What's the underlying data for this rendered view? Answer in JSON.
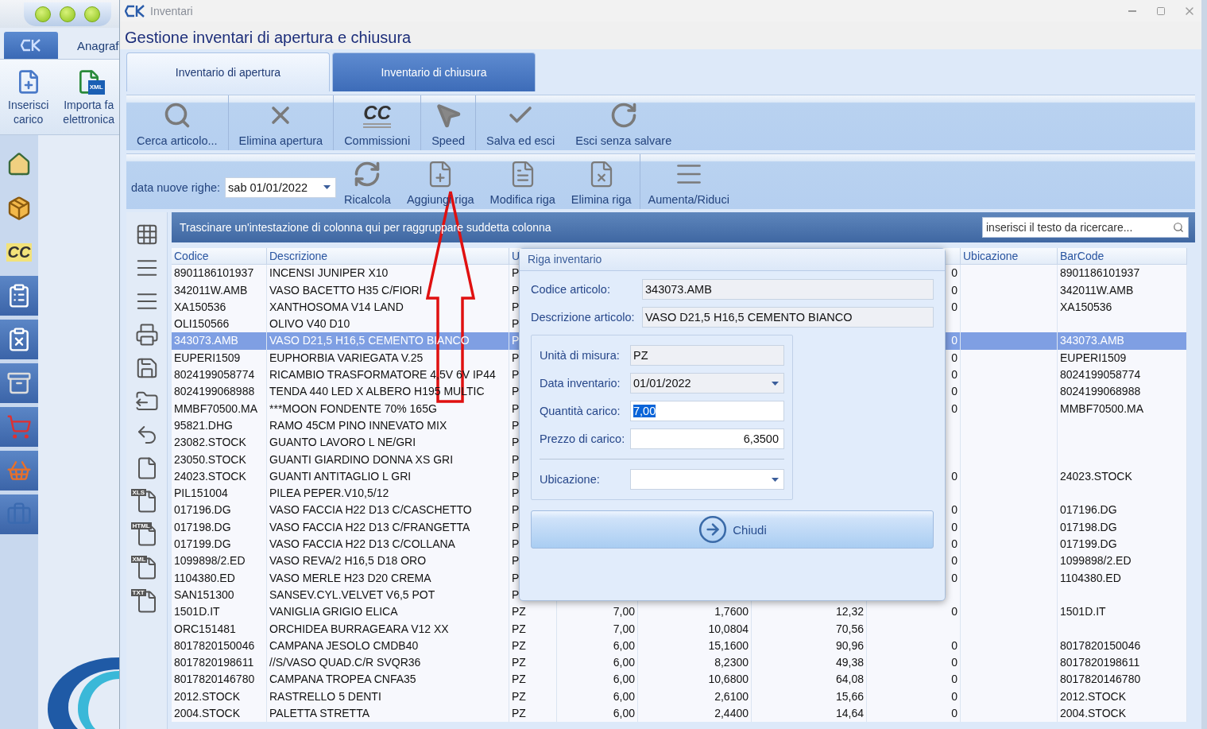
{
  "app_sidebar": {
    "tab_label": "Anagraf",
    "ribbon": [
      {
        "kind": "insert",
        "lines": [
          "Inserisci",
          "carico"
        ]
      },
      {
        "kind": "xml",
        "badge": "XML",
        "lines": [
          "Importa fa",
          "elettronica"
        ]
      }
    ],
    "nav": [
      {
        "kind": "home"
      },
      {
        "kind": "boxes"
      },
      {
        "kind": "cc",
        "text": "CC"
      },
      {
        "kind": "list-user"
      },
      {
        "kind": "list-red"
      },
      {
        "kind": "archive"
      },
      {
        "kind": "cart"
      },
      {
        "kind": "basket"
      },
      {
        "kind": "briefcase"
      }
    ]
  },
  "window": {
    "title": "Inventari",
    "heading": "Gestione inventari di apertura e chiusura"
  },
  "tabs": [
    {
      "label": "Inventario di apertura",
      "selected": true
    },
    {
      "label": "Inventario di chiusura",
      "selected": false
    }
  ],
  "toolbar": [
    {
      "kind": "search",
      "label": "Cerca articolo..."
    },
    {
      "kind": "delete",
      "label": "Elimina apertura"
    },
    {
      "kind": "cc",
      "label": "Commissioni",
      "icon_text": "CC"
    },
    {
      "kind": "speed",
      "label": "Speed"
    },
    {
      "kind": "save",
      "label": "Salva ed esci"
    },
    {
      "kind": "redo",
      "label": "Esci senza salvare"
    }
  ],
  "toolbar2": {
    "date_label": "data nuove righe:",
    "date_value": "sab 01/01/2022",
    "buttons": [
      {
        "kind": "refresh",
        "label": "Ricalcola"
      },
      {
        "kind": "add",
        "label": "Aggiungi riga"
      },
      {
        "kind": "edit",
        "label": "Modifica riga"
      },
      {
        "kind": "remove",
        "label": "Elimina riga"
      },
      {
        "kind": "resize",
        "label": "Aumenta/Riduci"
      }
    ]
  },
  "grid": {
    "group_hint": "Trascinare un'intestazione di colonna qui per raggruppare suddetta colonna",
    "search_placeholder": "inserisci il testo da ricercare...",
    "side_buttons": [
      {
        "kind": "grid"
      },
      {
        "kind": "list"
      },
      {
        "kind": "list"
      },
      {
        "kind": "printer"
      },
      {
        "kind": "save"
      },
      {
        "kind": "export"
      },
      {
        "kind": "undo"
      },
      {
        "kind": "file"
      },
      {
        "kind": "file",
        "badge": "XLS"
      },
      {
        "kind": "file",
        "badge": "HTML"
      },
      {
        "kind": "file",
        "badge": "XML"
      },
      {
        "kind": "file",
        "badge": "TXT"
      }
    ],
    "header": {
      "codice": "Codice",
      "descrizione": "Descrizione",
      "u": "U",
      "ubicazione": "Ubicazione",
      "barcode": "BarCode"
    },
    "rows": [
      {
        "code": "8901186101937",
        "desc": "INCENSI JUNIPER X10",
        "u": "P",
        "col_7": "0",
        "barcode": "8901186101937",
        "selected": false
      },
      {
        "code": "342011W.AMB",
        "desc": "VASO BACETTO H35 C/FIORI",
        "u": "P",
        "col_7": "0",
        "barcode": "342011W.AMB",
        "selected": false
      },
      {
        "code": "XA150536",
        "desc": "XANTHOSOMA V14 LAND",
        "u": "P",
        "col_7": "0",
        "barcode": "XA150536",
        "selected": false
      },
      {
        "code": "OLI150566",
        "desc": "OLIVO V40 D10",
        "u": "P",
        "selected": false
      },
      {
        "code": "343073.AMB",
        "desc": "VASO D21,5 H16,5 CEMENTO BIANCO",
        "u": "P",
        "col_7": "0",
        "barcode": "343073.AMB",
        "selected": true
      },
      {
        "code": "EUPERI1509",
        "desc": "EUPHORBIA VARIEGATA V.25",
        "u": "P",
        "col_7": "0",
        "barcode": "EUPERI1509",
        "selected": false
      },
      {
        "code": "8024199058774",
        "desc": "RICAMBIO TRASFORMATORE 4,5V 6V IP44",
        "u": "P",
        "col_7": "0",
        "barcode": "8024199058774",
        "selected": false
      },
      {
        "code": "8024199068988",
        "desc": "TENDA 440 LED X ALBERO H195 MULTIC",
        "u": "P",
        "col_7": "0",
        "barcode": "8024199068988",
        "selected": false
      },
      {
        "code": "MMBF70500.MA",
        "desc": "***MOON FONDENTE 70% 165G",
        "u": "P",
        "col_7": "0",
        "barcode": "MMBF70500.MA",
        "selected": false
      },
      {
        "code": "95821.DHG",
        "desc": "RAMO 45CM PINO INNEVATO MIX",
        "u": "P",
        "selected": false
      },
      {
        "code": "23082.STOCK",
        "desc": "GUANTO LAVORO L NE/GRI",
        "u": "P",
        "selected": false
      },
      {
        "code": "23050.STOCK",
        "desc": "GUANTI GIARDINO DONNA XS GRI",
        "u": "P",
        "selected": false
      },
      {
        "code": "24023.STOCK",
        "desc": "GUANTI ANTITAGLIO L GRI",
        "u": "P",
        "col_7": "0",
        "barcode": "24023.STOCK",
        "selected": false
      },
      {
        "code": "PIL151004",
        "desc": "PILEA PEPER.V10,5/12",
        "u": "P",
        "selected": false
      },
      {
        "code": "017196.DG",
        "desc": "VASO FACCIA H22 D13 C/CASCHETTO",
        "u": "P",
        "col_7": "0",
        "barcode": "017196.DG",
        "selected": false
      },
      {
        "code": "017198.DG",
        "desc": "VASO FACCIA H22 D13 C/FRANGETTA",
        "u": "P",
        "col_7": "0",
        "barcode": "017198.DG",
        "selected": false
      },
      {
        "code": "017199.DG",
        "desc": "VASO FACCIA H22 D13 C/COLLANA",
        "u": "P",
        "col_7": "0",
        "barcode": "017199.DG",
        "selected": false
      },
      {
        "code": "1099898/2.ED",
        "desc": "VASO REVA/2 H16,5 D18 ORO",
        "u": "P",
        "col_7": "0",
        "barcode": "1099898/2.ED",
        "selected": false
      },
      {
        "code": "1104380.ED",
        "desc": "VASO MERLE H23 D20 CREMA",
        "u": "P",
        "col_7": "0",
        "barcode": "1104380.ED",
        "selected": false
      },
      {
        "code": "SAN151300",
        "desc": "SANSEV.CYL.VELVET V6,5 POT",
        "u": "P",
        "selected": false
      },
      {
        "code": "1501D.IT",
        "desc": "VANIGLIA GRIGIO ELICA",
        "u": "PZ",
        "qty": "7,00",
        "price": "1,7600",
        "total": "12,32",
        "col_7": "0",
        "barcode": "1501D.IT",
        "selected": false
      },
      {
        "code": "ORC151481",
        "desc": "ORCHIDEA BURRAGEARA V12 XX",
        "u": "PZ",
        "qty": "7,00",
        "price": "10,0804",
        "total": "70,56",
        "selected": false
      },
      {
        "code": "8017820150046",
        "desc": "CAMPANA JESOLO CMDB40",
        "u": "PZ",
        "qty": "6,00",
        "price": "15,1600",
        "total": "90,96",
        "col_7": "0",
        "barcode": "8017820150046",
        "selected": false
      },
      {
        "code": "8017820198611",
        "desc": "//S/VASO QUAD.C/R SVQR36",
        "u": "PZ",
        "qty": "6,00",
        "price": "8,2300",
        "total": "49,38",
        "col_7": "0",
        "barcode": "8017820198611",
        "selected": false
      },
      {
        "code": "8017820146780",
        "desc": "CAMPANA TROPEA CNFA35",
        "u": "PZ",
        "qty": "6,00",
        "price": "10,6800",
        "total": "64,08",
        "col_7": "0",
        "barcode": "8017820146780",
        "selected": false
      },
      {
        "code": "2012.STOCK",
        "desc": "RASTRELLO 5 DENTI",
        "u": "PZ",
        "qty": "6,00",
        "price": "2,6100",
        "total": "15,66",
        "col_7": "0",
        "barcode": "2012.STOCK",
        "selected": false
      },
      {
        "code": "2004.STOCK",
        "desc": "PALETTA STRETTA",
        "u": "PZ",
        "qty": "6,00",
        "price": "2,4400",
        "total": "14,64",
        "col_7": "0",
        "barcode": "2004.STOCK",
        "selected": false
      }
    ]
  },
  "dialog": {
    "title": "Riga inventario",
    "top_fields": [
      {
        "label": "Codice articolo:",
        "value": "343073.AMB",
        "kind": "readonly"
      },
      {
        "label": "Descrizione articolo:",
        "value": "VASO D21,5 H16,5 CEMENTO BIANCO",
        "kind": "readonly"
      }
    ],
    "group_fields": [
      {
        "label": "Unità di misura:",
        "value": "PZ",
        "kind": "readonly"
      },
      {
        "label": "Data inventario:",
        "value": "01/01/2022",
        "kind": "dropdown"
      },
      {
        "label": "Quantità carico:",
        "value": "7,00",
        "kind": "input",
        "highlighted": true
      },
      {
        "label": "Prezzo di carico:",
        "value": "6,3500",
        "kind": "number",
        "highlighted": false
      },
      {
        "kind": "separator"
      },
      {
        "label": "Ubicazione:",
        "kind": "dropdown"
      }
    ],
    "button": "Chiudi"
  }
}
